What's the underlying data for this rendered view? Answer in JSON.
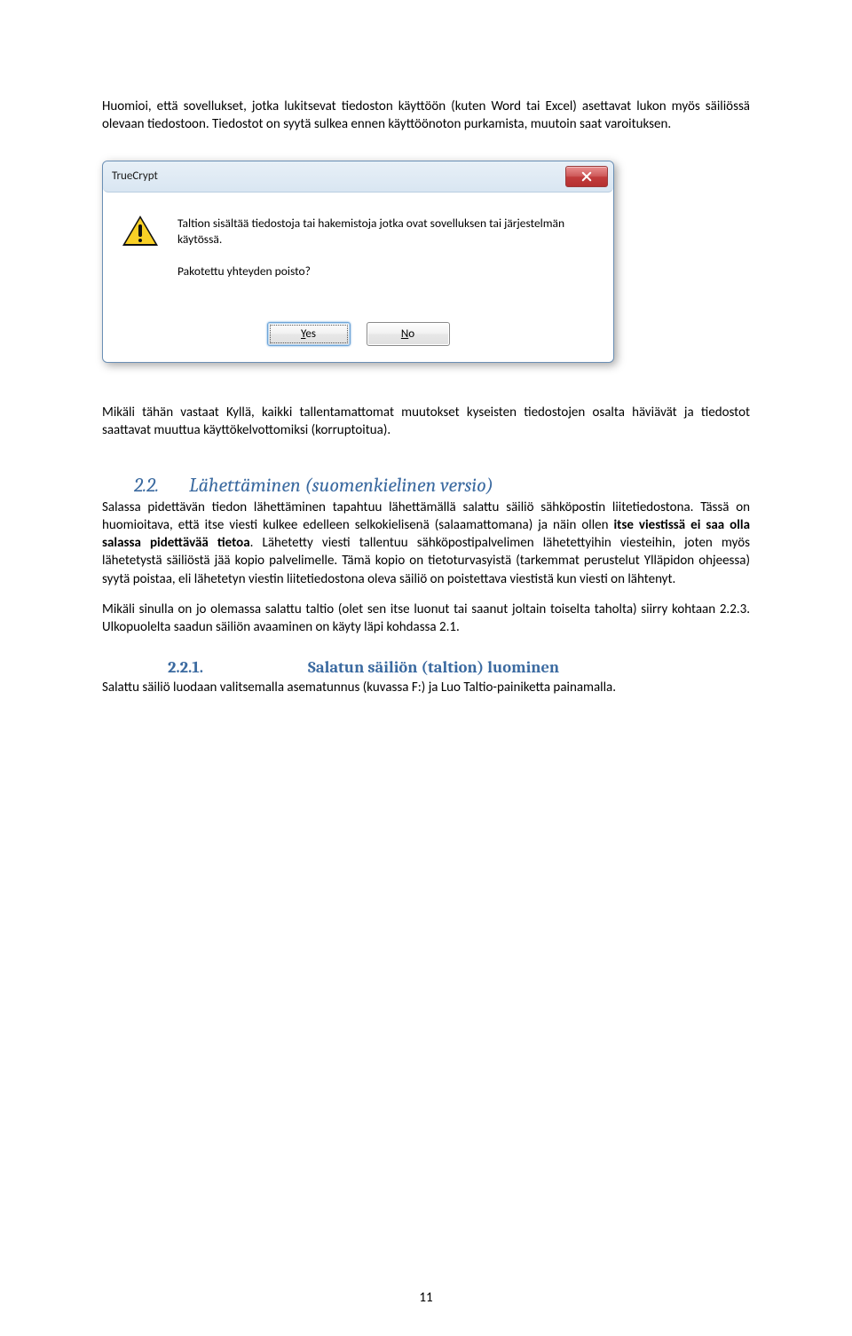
{
  "intro": {
    "p1": "Huomioi, että sovellukset, jotka lukitsevat tiedoston käyttöön (kuten Word tai Excel)  asettavat lukon myös säiliössä   olevaan tiedostoon. Tiedostot on syytä sulkea ennen käyttöönoton purkamista, muutoin saat varoituksen."
  },
  "dialog": {
    "title": "TrueCrypt",
    "message_line1": "Taltion sisältää tiedostoja tai hakemistoja jotka ovat sovelluksen tai järjestelmän käytössä.",
    "message_line2": "Pakotettu yhteyden poisto?",
    "yes": "Yes",
    "no": "No"
  },
  "afterDialog": {
    "p": "Mikäli tähän vastaat Kyllä, kaikki tallentamattomat muutokset kyseisten tiedostojen osalta häviävät ja tiedostot saattavat muuttua käyttökelvottomiksi (korruptoitua)."
  },
  "sec22": {
    "num": "2.2.",
    "title": "Lähettäminen (suomenkielinen versio)",
    "p1a": "Salassa pidettävän tiedon lähettäminen tapahtuu lähettämällä salattu säiliö sähköpostin liitetiedostona. Tässä on huomioitava, että itse viesti kulkee edelleen selkokielisenä (salaamattomana) ja näin ollen ",
    "p1b": "itse viestissä ei saa olla salassa pidettävää tietoa",
    "p1c": ". Lähetetty viesti tallentuu sähköpostipalvelimen lähetettyihin viesteihin, joten myös lähetetystä säiliöstä jää kopio palvelimelle. Tämä kopio on tietoturvasyistä (tarkemmat perustelut Ylläpidon ohjeessa) syytä poistaa, eli lähetetyn viestin liitetiedostona oleva säiliö on poistettava viestistä kun viesti on lähtenyt.",
    "p2": "Mikäli sinulla on jo olemassa salattu taltio (olet sen itse luonut tai saanut joltain toiselta taholta) siirry kohtaan 2.2.3. Ulkopuolelta saadun säiliön avaaminen on käyty läpi kohdassa 2.1."
  },
  "sec221": {
    "num": "2.2.1.",
    "title": "Salatun säiliön (taltion) luominen",
    "p": "Salattu säiliö luodaan valitsemalla asematunnus (kuvassa F:) ja  Luo Taltio-painiketta painamalla."
  },
  "page_number": "11"
}
